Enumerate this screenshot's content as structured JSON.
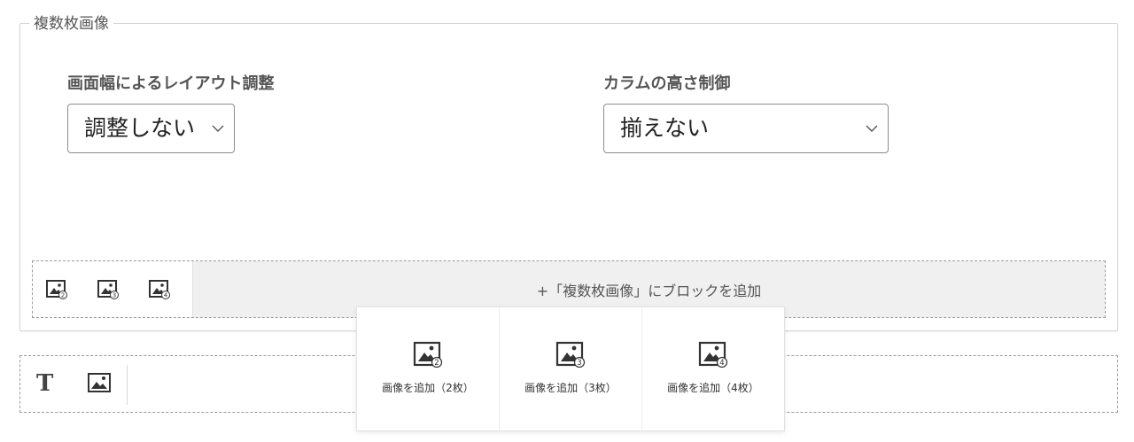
{
  "section": {
    "legend": "複数枚画像"
  },
  "fields": {
    "layout": {
      "label": "画面幅によるレイアウト調整",
      "value": "調整しない"
    },
    "height": {
      "label": "カラムの高さ制御",
      "value": "揃えない"
    }
  },
  "add_bar": {
    "add_label": "+「複数枚画像」にブロックを追加",
    "icon_counts": [
      "2",
      "3",
      "4"
    ]
  },
  "popover": {
    "options": [
      {
        "label": "画像を追加（2枚）",
        "count": "2"
      },
      {
        "label": "画像を追加（3枚）",
        "count": "3"
      },
      {
        "label": "画像を追加（4枚）",
        "count": "4"
      }
    ]
  },
  "icons": {
    "text_block": "text-icon",
    "image_block": "image-icon",
    "multi_image": "multi-image-icon",
    "select_arrow": "chevron-down-icon"
  }
}
